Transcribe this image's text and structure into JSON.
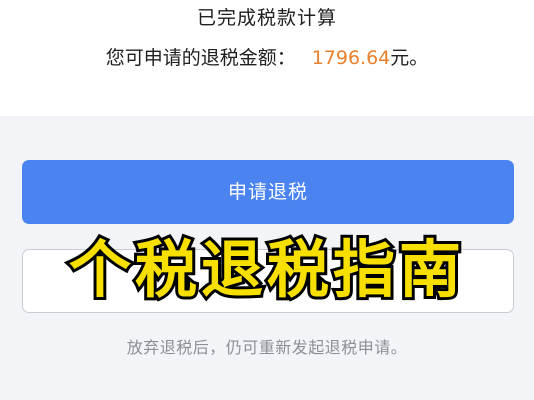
{
  "result": {
    "title": "已完成税款计算",
    "amount_label": "您可申请的退税金额：",
    "amount_value": "1796.64",
    "amount_unit": "元。"
  },
  "actions": {
    "primary_label": "申请退税",
    "secondary_label": ""
  },
  "hint": "放弃退税后，仍可重新发起退税申请。",
  "overlay": {
    "caption": "个税退税指南"
  },
  "colors": {
    "primary_button": "#4b84f1",
    "amount_accent": "#e8802c",
    "caption_fill": "#f7e000",
    "caption_stroke": "#000000"
  }
}
